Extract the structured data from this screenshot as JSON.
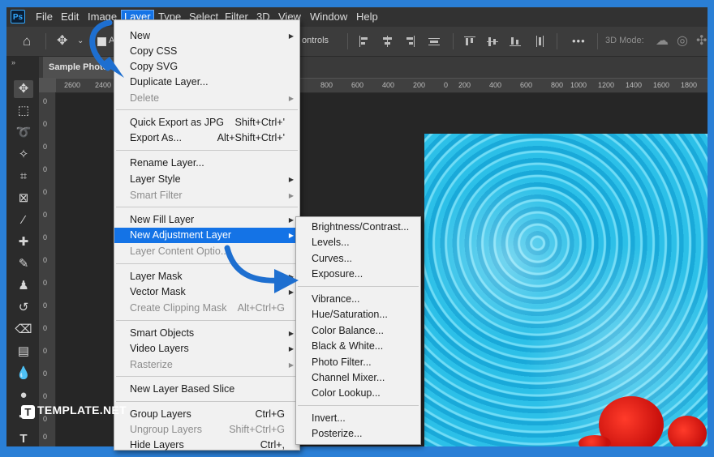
{
  "menubar": {
    "logo": "Ps",
    "items": [
      "File",
      "Edit",
      "Image",
      "Layer",
      "Type",
      "Select",
      "Filter",
      "3D",
      "View",
      "Window",
      "Help"
    ],
    "active": "Layer"
  },
  "options_bar": {
    "auto_select_label": "Au",
    "show_transform_label": "ontrols",
    "more": "•••",
    "mode_label": "3D Mode:"
  },
  "document": {
    "tab_title": "Sample Photo"
  },
  "ruler": {
    "top_ticks": [
      "2600",
      "2400",
      "800",
      "600",
      "400",
      "200",
      "0",
      "200",
      "400",
      "600",
      "800",
      "1000",
      "1200",
      "1400",
      "1600",
      "1800"
    ],
    "left_ticks": [
      "0",
      "0",
      "0",
      "0",
      "0",
      "0",
      "0",
      "0",
      "0",
      "0",
      "0",
      "0",
      "0",
      "0",
      "0",
      "0"
    ]
  },
  "layer_menu": {
    "items": [
      {
        "label": "New",
        "shortcut": "",
        "submenu": true,
        "disabled": false
      },
      {
        "label": "Copy CSS",
        "shortcut": "",
        "submenu": false,
        "disabled": false
      },
      {
        "label": "Copy SVG",
        "shortcut": "",
        "submenu": false,
        "disabled": false
      },
      {
        "label": "Duplicate Layer...",
        "shortcut": "",
        "submenu": false,
        "disabled": false
      },
      {
        "label": "Delete",
        "shortcut": "",
        "submenu": true,
        "disabled": true
      },
      {
        "label": "Quick Export as JPG",
        "shortcut": "Shift+Ctrl+'",
        "submenu": false,
        "disabled": false
      },
      {
        "label": "Export As...",
        "shortcut": "Alt+Shift+Ctrl+'",
        "submenu": false,
        "disabled": false
      },
      {
        "label": "Rename Layer...",
        "shortcut": "",
        "submenu": false,
        "disabled": false
      },
      {
        "label": "Layer Style",
        "shortcut": "",
        "submenu": true,
        "disabled": false
      },
      {
        "label": "Smart Filter",
        "shortcut": "",
        "submenu": true,
        "disabled": true
      },
      {
        "label": "New Fill Layer",
        "shortcut": "",
        "submenu": true,
        "disabled": false
      },
      {
        "label": "New Adjustment Layer",
        "shortcut": "",
        "submenu": true,
        "disabled": false,
        "highlighted": true
      },
      {
        "label": "Layer Content Optio...",
        "shortcut": "",
        "submenu": false,
        "disabled": true
      },
      {
        "label": "Layer Mask",
        "shortcut": "",
        "submenu": true,
        "disabled": false
      },
      {
        "label": "Vector Mask",
        "shortcut": "",
        "submenu": true,
        "disabled": false
      },
      {
        "label": "Create Clipping Mask",
        "shortcut": "Alt+Ctrl+G",
        "submenu": false,
        "disabled": true
      },
      {
        "label": "Smart Objects",
        "shortcut": "",
        "submenu": true,
        "disabled": false
      },
      {
        "label": "Video Layers",
        "shortcut": "",
        "submenu": true,
        "disabled": false
      },
      {
        "label": "Rasterize",
        "shortcut": "",
        "submenu": true,
        "disabled": true
      },
      {
        "label": "New Layer Based Slice",
        "shortcut": "",
        "submenu": false,
        "disabled": false
      },
      {
        "label": "Group Layers",
        "shortcut": "Ctrl+G",
        "submenu": false,
        "disabled": false
      },
      {
        "label": "Ungroup Layers",
        "shortcut": "Shift+Ctrl+G",
        "submenu": false,
        "disabled": true
      },
      {
        "label": "Hide Layers",
        "shortcut": "Ctrl+,",
        "submenu": false,
        "disabled": false
      }
    ]
  },
  "adjustment_submenu": {
    "items": [
      "Brightness/Contrast...",
      "Levels...",
      "Curves...",
      "Exposure...",
      "Vibrance...",
      "Hue/Saturation...",
      "Color Balance...",
      "Black & White...",
      "Photo Filter...",
      "Channel Mixer...",
      "Color Lookup...",
      "Invert...",
      "Posterize..."
    ]
  },
  "watermark": {
    "logo": "T",
    "text": "TEMPLATE.NET"
  },
  "colors": {
    "accent": "#1473e6",
    "annotation_arrow": "#1e6fd0",
    "frame": "#2a7fd6"
  }
}
